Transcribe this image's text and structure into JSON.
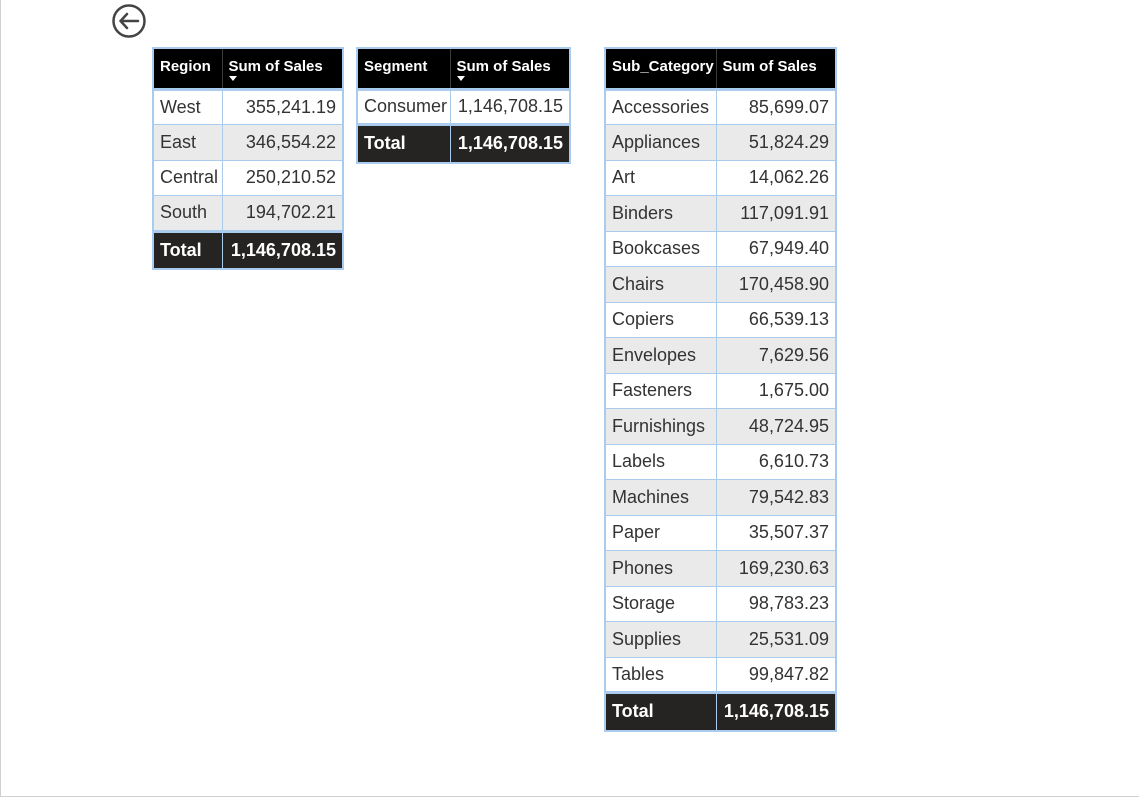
{
  "back_button": {
    "icon": "back-arrow-icon"
  },
  "region_table": {
    "headers": [
      "Region",
      "Sum of Sales"
    ],
    "rows": [
      [
        "West",
        "355,241.19"
      ],
      [
        "East",
        "346,554.22"
      ],
      [
        "Central",
        "250,210.52"
      ],
      [
        "South",
        "194,702.21"
      ]
    ],
    "total_label": "Total",
    "total_value": "1,146,708.15"
  },
  "segment_table": {
    "headers": [
      "Segment",
      "Sum of Sales"
    ],
    "rows": [
      [
        "Consumer",
        "1,146,708.15"
      ]
    ],
    "total_label": "Total",
    "total_value": "1,146,708.15"
  },
  "subcategory_table": {
    "headers": [
      "Sub_Category",
      "Sum of Sales"
    ],
    "rows": [
      [
        "Accessories",
        "85,699.07"
      ],
      [
        "Appliances",
        "51,824.29"
      ],
      [
        "Art",
        "14,062.26"
      ],
      [
        "Binders",
        "117,091.91"
      ],
      [
        "Bookcases",
        "67,949.40"
      ],
      [
        "Chairs",
        "170,458.90"
      ],
      [
        "Copiers",
        "66,539.13"
      ],
      [
        "Envelopes",
        "7,629.56"
      ],
      [
        "Fasteners",
        "1,675.00"
      ],
      [
        "Furnishings",
        "48,724.95"
      ],
      [
        "Labels",
        "6,610.73"
      ],
      [
        "Machines",
        "79,542.83"
      ],
      [
        "Paper",
        "35,507.37"
      ],
      [
        "Phones",
        "169,230.63"
      ],
      [
        "Storage",
        "98,783.23"
      ],
      [
        "Supplies",
        "25,531.09"
      ],
      [
        "Tables",
        "99,847.82"
      ]
    ],
    "total_label": "Total",
    "total_value": "1,146,708.15"
  },
  "colors": {
    "header_bg": "#000000",
    "total_bg": "#252423",
    "border": "#a9cbee",
    "alt_row": "#eaeaea"
  }
}
